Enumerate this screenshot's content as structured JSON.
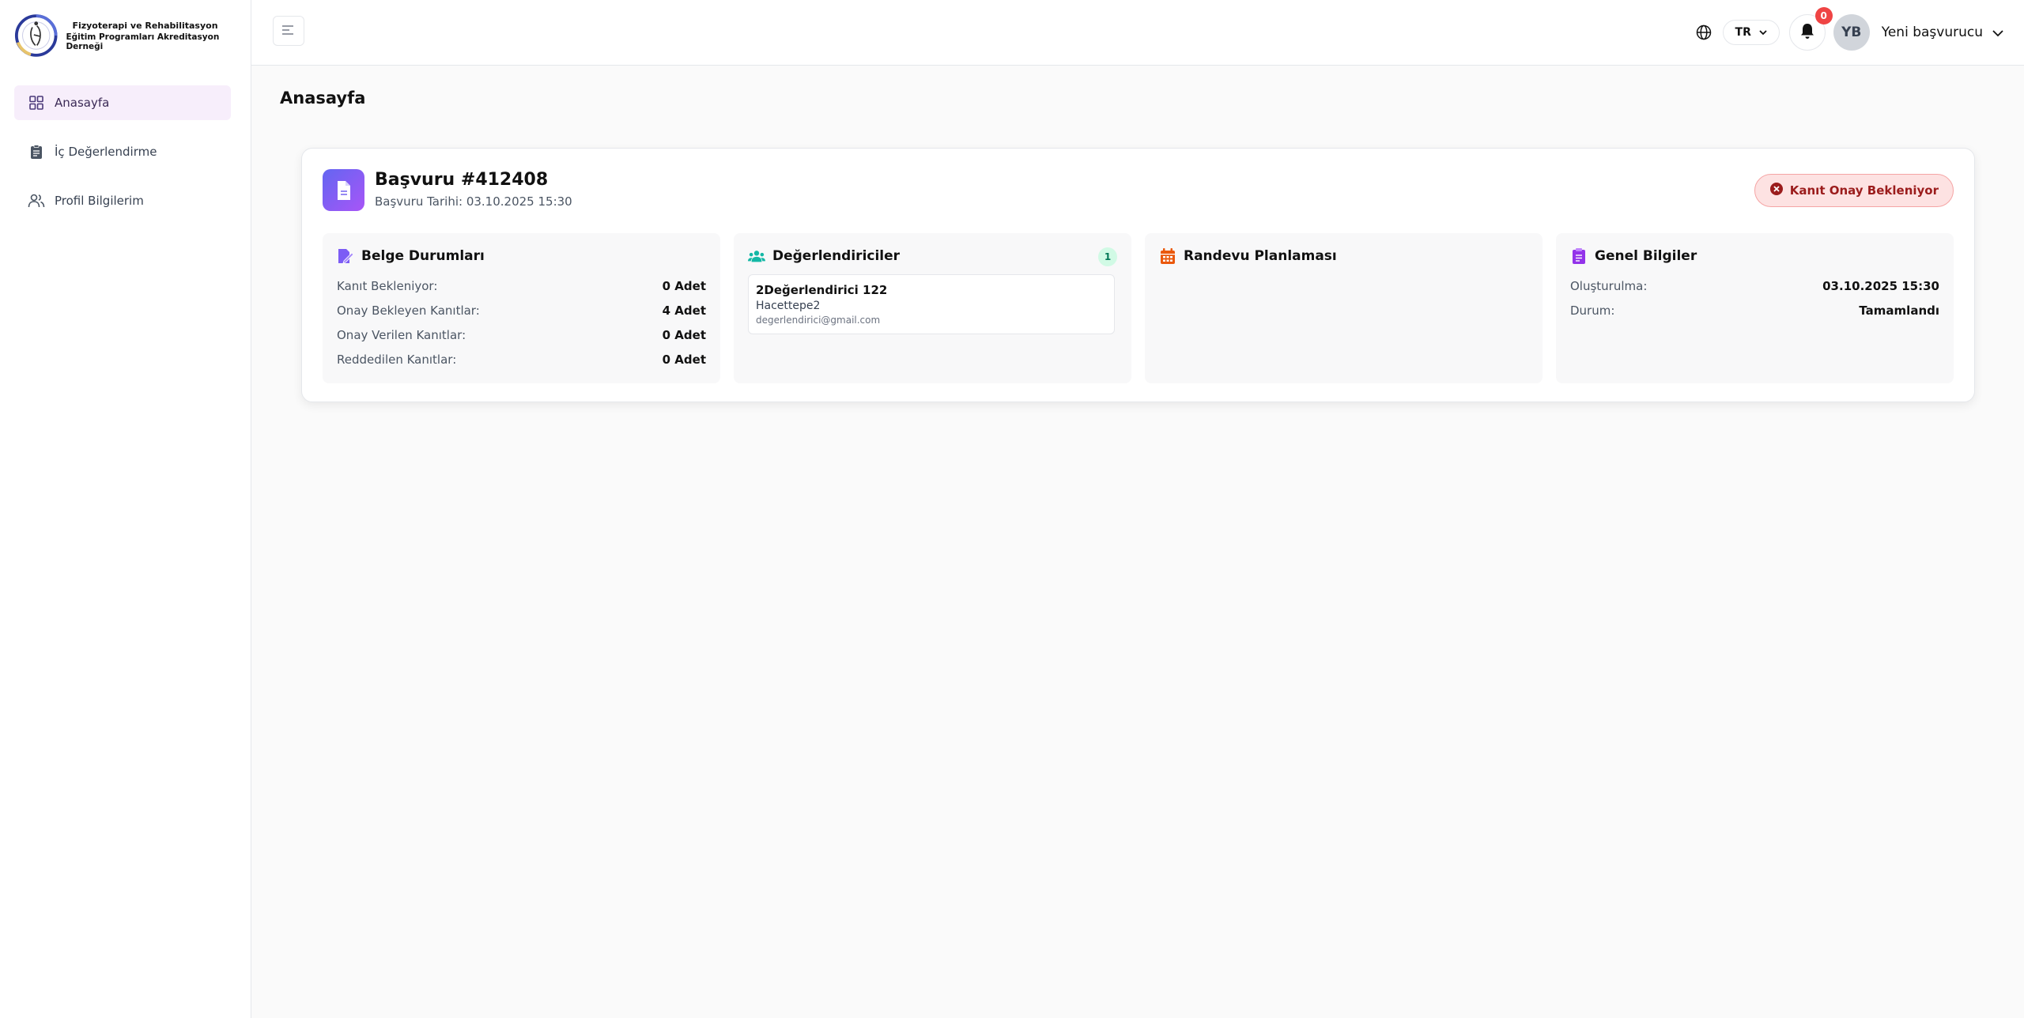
{
  "brand": {
    "line1": "Fizyoterapi ve Rehabilitasyon",
    "line2": "Eğitim Programları Akreditasyon Derneği"
  },
  "sidebar": {
    "items": [
      {
        "label": "Anasayfa",
        "icon": "dashboard-icon",
        "active": true
      },
      {
        "label": "İç Değerlendirme",
        "icon": "clipboard-icon",
        "active": false
      },
      {
        "label": "Profil Bilgilerim",
        "icon": "users-icon",
        "active": false
      }
    ]
  },
  "header": {
    "language": "TR",
    "notification_count": "0",
    "avatar_initials": "YB",
    "user_name": "Yeni başvurucu"
  },
  "page": {
    "title": "Anasayfa"
  },
  "application": {
    "title": "Başvuru #412408",
    "date": "Başvuru Tarihi: 03.10.2025 15:30",
    "status": "Kanıt Onay Bekleniyor"
  },
  "panels": {
    "documents": {
      "title": "Belge Durumları",
      "rows": [
        {
          "label": "Kanıt Bekleniyor:",
          "value": "0 Adet"
        },
        {
          "label": "Onay Bekleyen Kanıtlar:",
          "value": "4 Adet"
        },
        {
          "label": "Onay Verilen Kanıtlar:",
          "value": "0 Adet"
        },
        {
          "label": "Reddedilen Kanıtlar:",
          "value": "0 Adet"
        }
      ]
    },
    "evaluators": {
      "title": "Değerlendiriciler",
      "count": "1",
      "items": [
        {
          "name": "2Değerlendirici 122",
          "org": "Hacettepe2",
          "email": "degerlendirici@gmail.com"
        }
      ]
    },
    "appointment": {
      "title": "Randevu Planlaması"
    },
    "general": {
      "title": "Genel Bilgiler",
      "rows": [
        {
          "label": "Oluşturulma:",
          "value": "03.10.2025 15:30"
        },
        {
          "label": "Durum:",
          "value": "Tamamlandı"
        }
      ]
    }
  },
  "colors": {
    "accent": "#6d5bd0",
    "active_nav_bg": "#f7eefb",
    "status_bg": "#fde2e2",
    "status_text": "#9b1c1c",
    "badge_red": "#ef4444"
  }
}
